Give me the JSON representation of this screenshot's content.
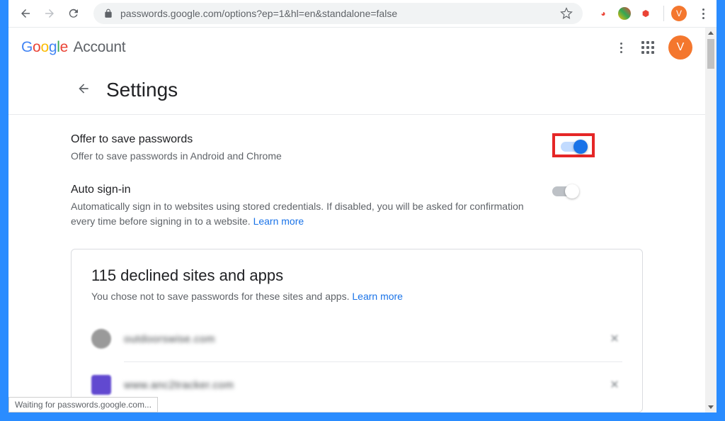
{
  "browser": {
    "url": "passwords.google.com/options?ep=1&hl=en&standalone=false",
    "status": "Waiting for passwords.google.com...",
    "avatar_initial": "V"
  },
  "header": {
    "logo_letters": [
      "G",
      "o",
      "o",
      "g",
      "l",
      "e"
    ],
    "account_label": "Account",
    "avatar_initial": "V"
  },
  "title": "Settings",
  "settings": {
    "offer": {
      "name": "Offer to save passwords",
      "desc": "Offer to save passwords in Android and Chrome",
      "on": true,
      "highlighted": true
    },
    "autosignin": {
      "name": "Auto sign-in",
      "desc": "Automatically sign in to websites using stored credentials. If disabled, you will be asked for confirmation every time before signing in to a website. ",
      "learn_more": "Learn more",
      "on": false
    }
  },
  "declined": {
    "heading": "115 declined sites and apps",
    "sub": "You chose not to save passwords for these sites and apps. ",
    "learn_more": "Learn more",
    "rows": [
      {
        "site": "outdoorswise.com"
      },
      {
        "site": "www.anc2tracker.com"
      }
    ]
  }
}
